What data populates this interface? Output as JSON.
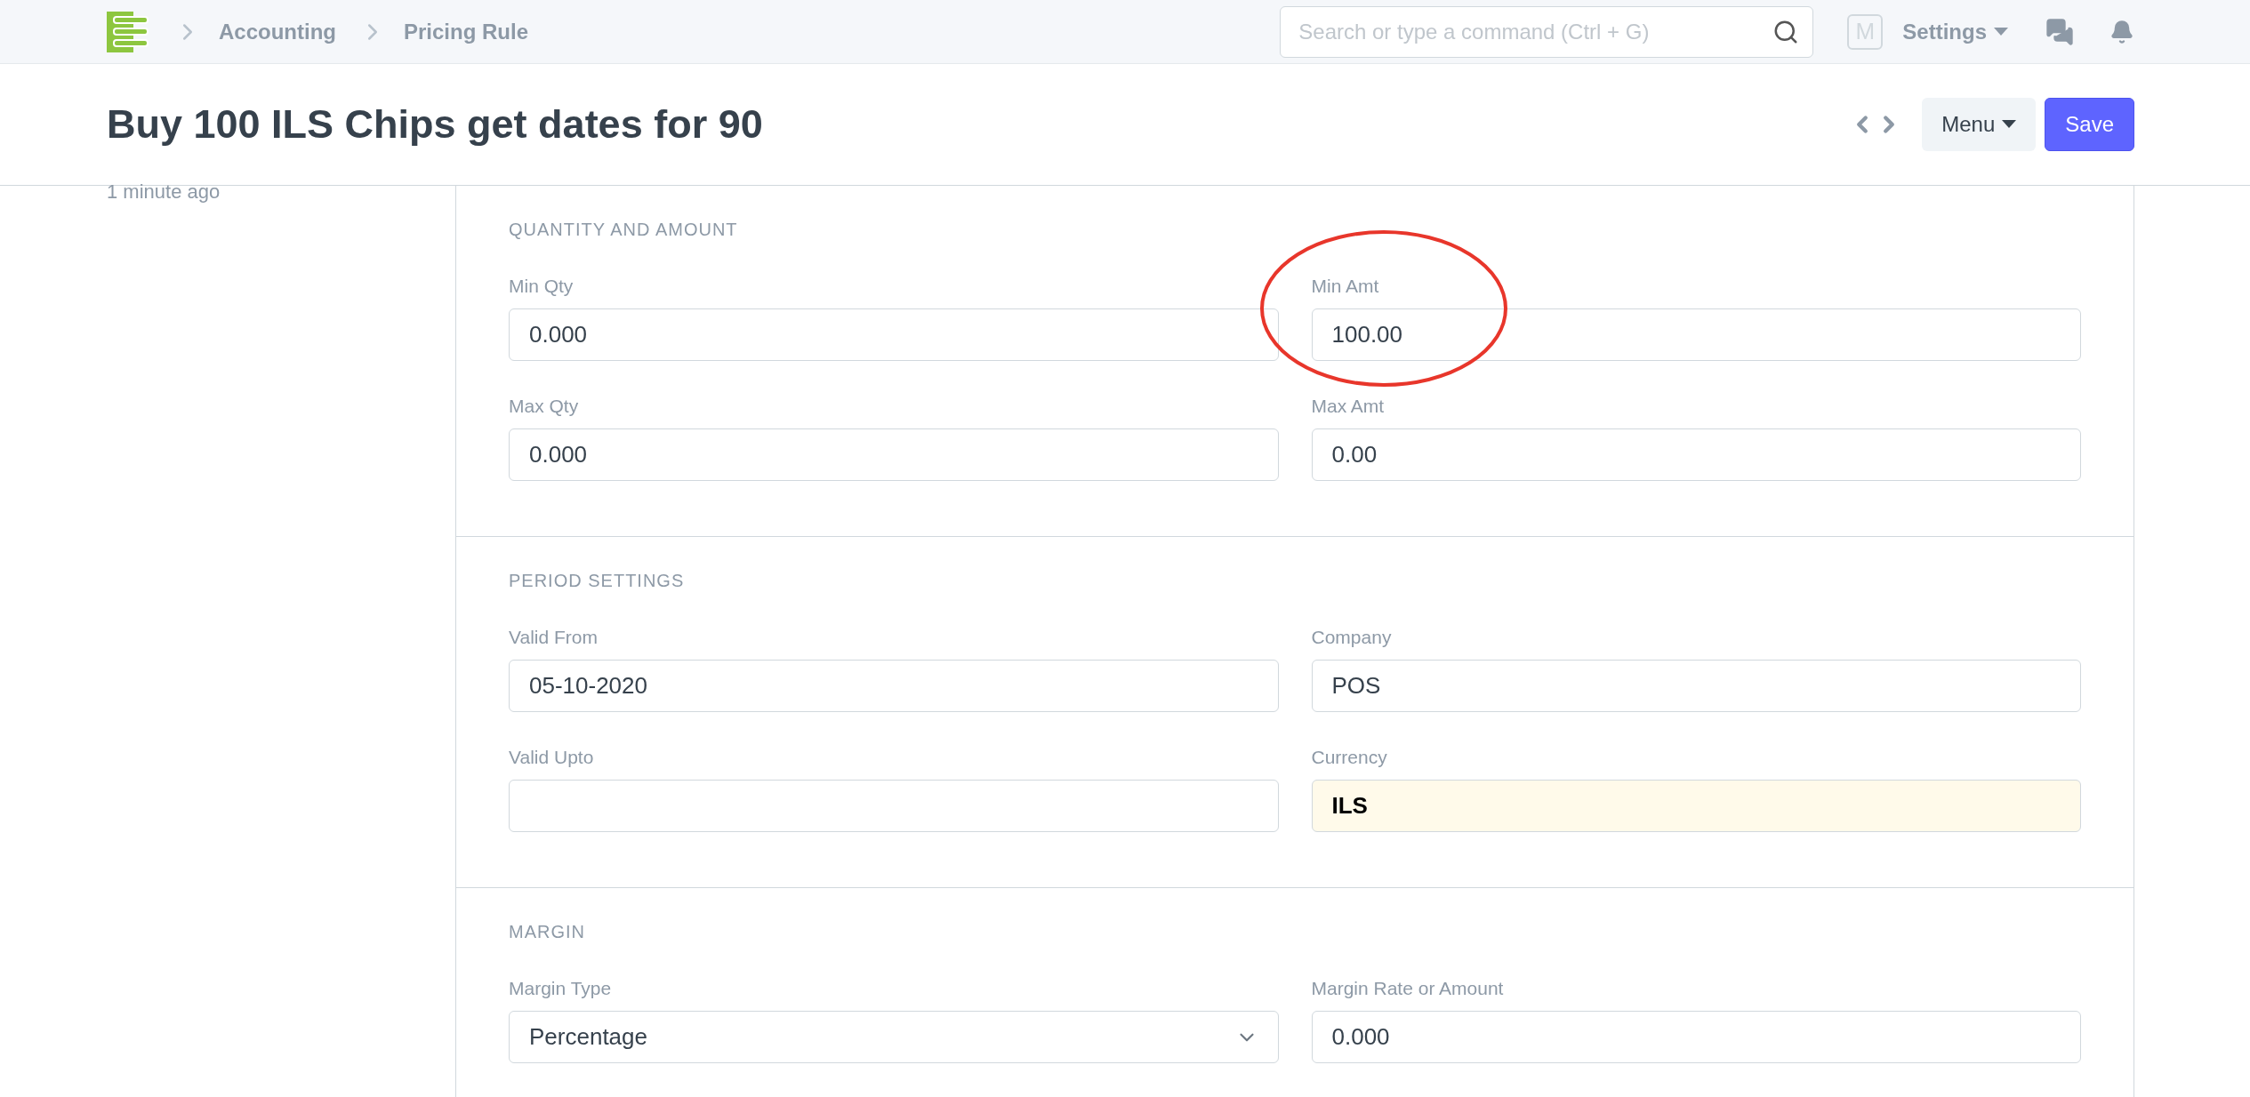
{
  "navbar": {
    "breadcrumbs": [
      "Accounting",
      "Pricing Rule"
    ],
    "search": {
      "placeholder": "Search or type a command (Ctrl + G)"
    },
    "avatar": "M",
    "settings": "Settings"
  },
  "header": {
    "title": "Buy 100 ILS Chips get dates for 90",
    "menu": "Menu",
    "save": "Save"
  },
  "sidebar": {
    "modified": "1 minute ago"
  },
  "sections": [
    {
      "title": "QUANTITY AND AMOUNT",
      "fields": [
        {
          "label": "Min Qty",
          "value": "0.000",
          "kind": "input",
          "highlighted": false
        },
        {
          "label": "Min Amt",
          "value": "100.00",
          "kind": "input",
          "highlighted": false
        },
        {
          "label": "Max Qty",
          "value": "0.000",
          "kind": "input",
          "highlighted": false
        },
        {
          "label": "Max Amt",
          "value": "0.00",
          "kind": "input",
          "highlighted": false
        }
      ]
    },
    {
      "title": "PERIOD SETTINGS",
      "fields": [
        {
          "label": "Valid From",
          "value": "05-10-2020",
          "kind": "input",
          "highlighted": false
        },
        {
          "label": "Company",
          "value": "POS",
          "kind": "input",
          "highlighted": false
        },
        {
          "label": "Valid Upto",
          "kind": "input",
          "highlighted": false
        },
        {
          "label": "Currency",
          "value": "ILS",
          "kind": "input",
          "highlighted": true
        }
      ]
    },
    {
      "title": "MARGIN",
      "fields": [
        {
          "label": "Margin Type",
          "value": "Percentage",
          "kind": "select",
          "highlighted": false
        },
        {
          "label": "Margin Rate or Amount",
          "value": "0.000",
          "kind": "input",
          "highlighted": false
        }
      ]
    }
  ]
}
